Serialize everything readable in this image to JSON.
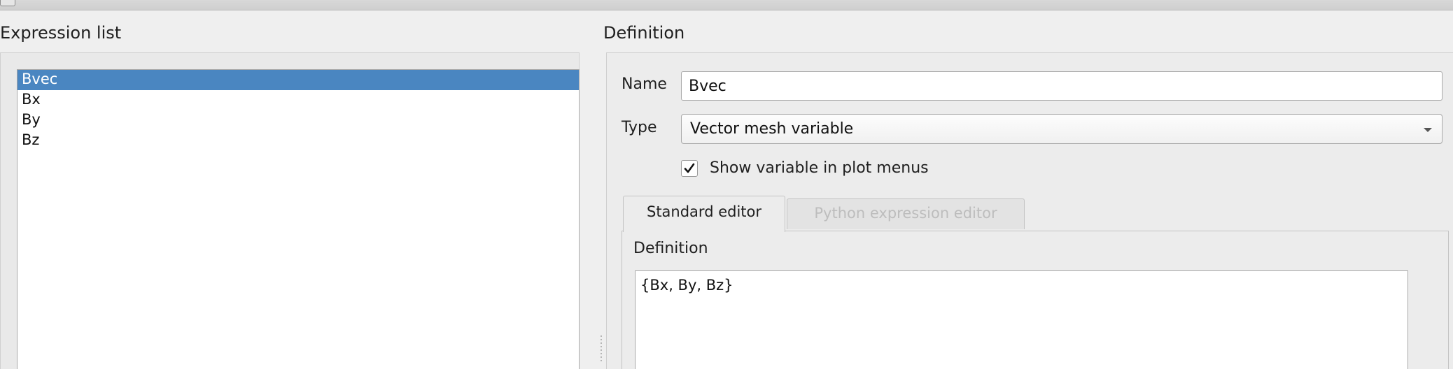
{
  "expression_list": {
    "label": "Expression list",
    "items": [
      "Bvec",
      "Bx",
      "By",
      "Bz"
    ],
    "selected_index": 0
  },
  "definition": {
    "group_label": "Definition",
    "name_label": "Name",
    "name_value": "Bvec",
    "type_label": "Type",
    "type_value": "Vector mesh variable",
    "show_in_plot_menus_label": "Show variable in plot menus",
    "show_in_plot_menus_checked": true,
    "tabs": [
      "Standard editor",
      "Python expression editor"
    ],
    "active_tab": 0,
    "editor_label": "Definition",
    "editor_value": "{Bx, By, Bz}"
  },
  "colors": {
    "selection": "#4a86c1",
    "background": "#efefef",
    "disabled_text": "#bdbdbd"
  }
}
